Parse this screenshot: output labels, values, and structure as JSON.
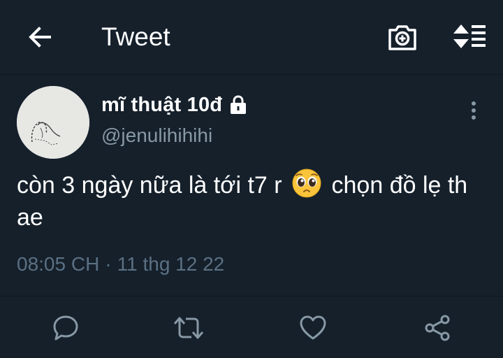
{
  "header": {
    "title": "Tweet",
    "back_icon": "arrow-left-icon",
    "camera_icon": "camera-plus-icon",
    "sort_icon": "sort-arrows-list-icon"
  },
  "tweet": {
    "display_name": "mĩ thuật 10đ",
    "handle": "@jenulihihihi",
    "protected": true,
    "text_part1": "còn 3 ngày nữa là tới t7 r",
    "emoji_name": "pleading-face-emoji",
    "text_part2": "chọn đồ lẹ th ae",
    "time": "08:05 CH",
    "separator": "·",
    "date": "11 thg 12 22"
  },
  "actions": {
    "reply_icon": "reply-bubble-icon",
    "retweet_icon": "retweet-icon",
    "like_icon": "heart-icon",
    "share_icon": "share-icon"
  },
  "colors": {
    "background": "#15202b",
    "text_primary": "#ffffff",
    "text_secondary": "#8899a6",
    "text_muted": "#5b7083"
  }
}
